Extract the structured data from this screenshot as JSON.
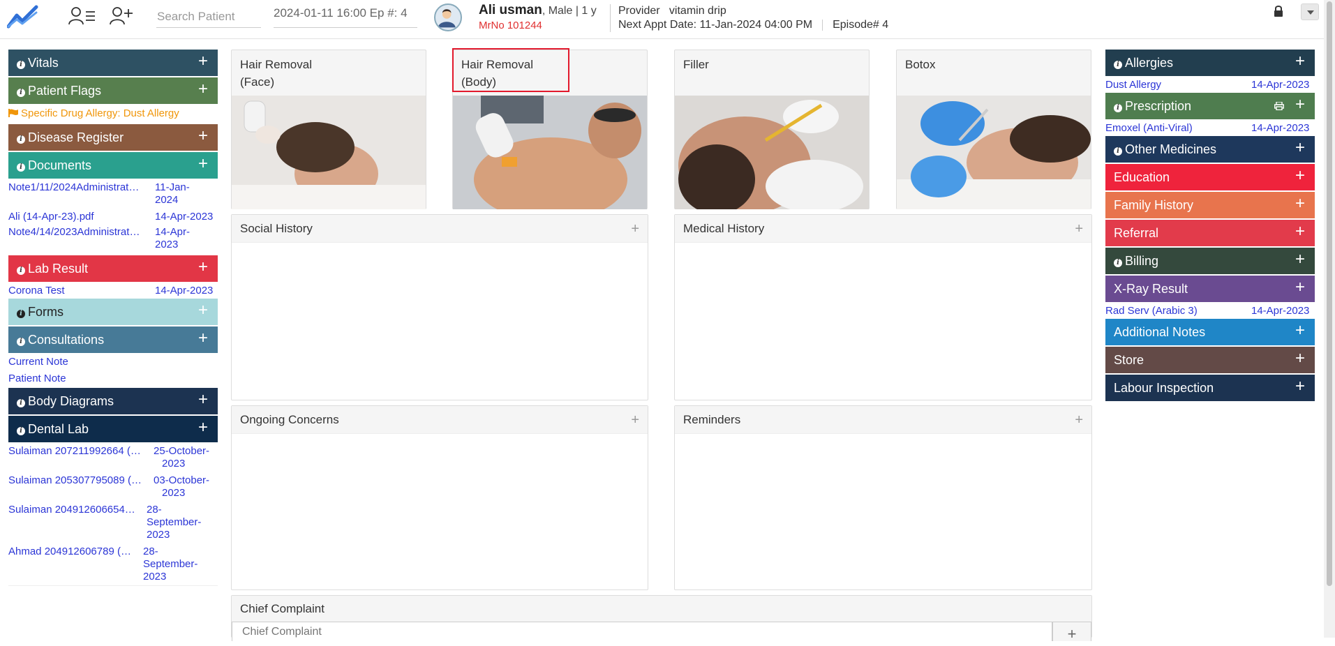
{
  "topbar": {
    "search_placeholder": "Search Patient",
    "episode_value": "2024-01-11 16:00 Ep #: 4",
    "patient_name": "Ali usman",
    "patient_meta": ", Male | 1 y",
    "mrno": "MrNo 101244",
    "provider_label": "Provider",
    "provider_value": "vitamin drip",
    "next_appt_label": "Next Appt Date",
    "next_appt_value": ": 11-Jan-2024 04:00 PM",
    "episode_label": "Episode# 4"
  },
  "colors": {
    "vitals": "#2e5163",
    "patient_flags": "#577f4e",
    "disease_register": "#8b5a3f",
    "documents": "#2aa08e",
    "lab_result": "#e23646",
    "forms": "#a7d8dc",
    "consultations": "#477a97",
    "body_diagrams": "#1c3351",
    "dental_lab": "#0e2c4b",
    "allergies": "#223e4f",
    "prescription": "#4f7d4f",
    "other_medicines": "#1e385c",
    "education": "#ef233c",
    "family_history": "#e8744d",
    "referral": "#e23b4b",
    "billing": "#34493d",
    "xray_result": "#6a4b91",
    "additional_notes": "#1f86c7",
    "store": "#634a47",
    "labour_inspection": "#1c3351",
    "link": "#2b35d6",
    "flag": "#f0960a",
    "highlight": "#e2192c"
  },
  "left": {
    "vitals": "Vitals",
    "patient_flags": "Patient Flags",
    "flag_text": "Specific Drug Allergy: Dust Allergy",
    "disease_register": "Disease Register",
    "documents": "Documents",
    "documents_items": [
      {
        "name": "Note1/11/2024Administrat…",
        "date1": "11-Jan-",
        "date2": "2024"
      },
      {
        "name": "Ali (14-Apr-23).pdf",
        "date1": "14-Apr-2023",
        "date2": ""
      },
      {
        "name": "Note4/14/2023Administrat…",
        "date1": "14-Apr-",
        "date2": "2023"
      }
    ],
    "lab_result": "Lab Result",
    "lab_items": [
      {
        "name": "Corona Test",
        "date": "14-Apr-2023"
      }
    ],
    "forms": "Forms",
    "consultations": "Consultations",
    "consult_items": [
      "Current Note",
      "Patient Note"
    ],
    "body_diagrams": "Body Diagrams",
    "dental_lab": "Dental Lab",
    "dental_items": [
      {
        "name": "Sulaiman 207211992664 (…",
        "d1": "25-October-",
        "d2": "2023",
        "d3": ""
      },
      {
        "name": "Sulaiman 205307795089 (…",
        "d1": "03-October-",
        "d2": "2023",
        "d3": ""
      },
      {
        "name": "Sulaiman 204912606654…",
        "d1": "28-",
        "d2": "September-",
        "d3": "2023"
      },
      {
        "name": "Ahmad 204912606789 (…",
        "d1": "28-",
        "d2": "September-",
        "d3": "2023"
      }
    ]
  },
  "procedures": [
    {
      "line1": "Hair Removal",
      "line2": "(Face)"
    },
    {
      "line1": "Hair Removal",
      "line2": "(Body)"
    },
    {
      "line1": "Filler",
      "line2": ""
    },
    {
      "line1": "Botox",
      "line2": ""
    }
  ],
  "panels": {
    "social_history": "Social History",
    "medical_history": "Medical History",
    "ongoing_concerns": "Ongoing Concerns",
    "reminders": "Reminders",
    "chief_complaint": "Chief Complaint",
    "chief_complaint_placeholder": "Chief Complaint"
  },
  "right": {
    "allergies": "Allergies",
    "allergy_item": {
      "name": "Dust Allergy",
      "date": "14-Apr-2023"
    },
    "prescription": "Prescription",
    "prescription_item": {
      "name": "Emoxel (Anti-Viral)",
      "date": "14-Apr-2023"
    },
    "other_medicines": "Other Medicines",
    "education": "Education",
    "family_history": "Family History",
    "referral": "Referral",
    "billing": "Billing",
    "xray_result": "X-Ray Result",
    "xray_item": {
      "name": "Rad Serv (Arabic 3)",
      "date": "14-Apr-2023"
    },
    "additional_notes": "Additional Notes",
    "store": "Store",
    "labour_inspection": "Labour Inspection"
  },
  "icons": {
    "plus": "+",
    "info": "i"
  }
}
